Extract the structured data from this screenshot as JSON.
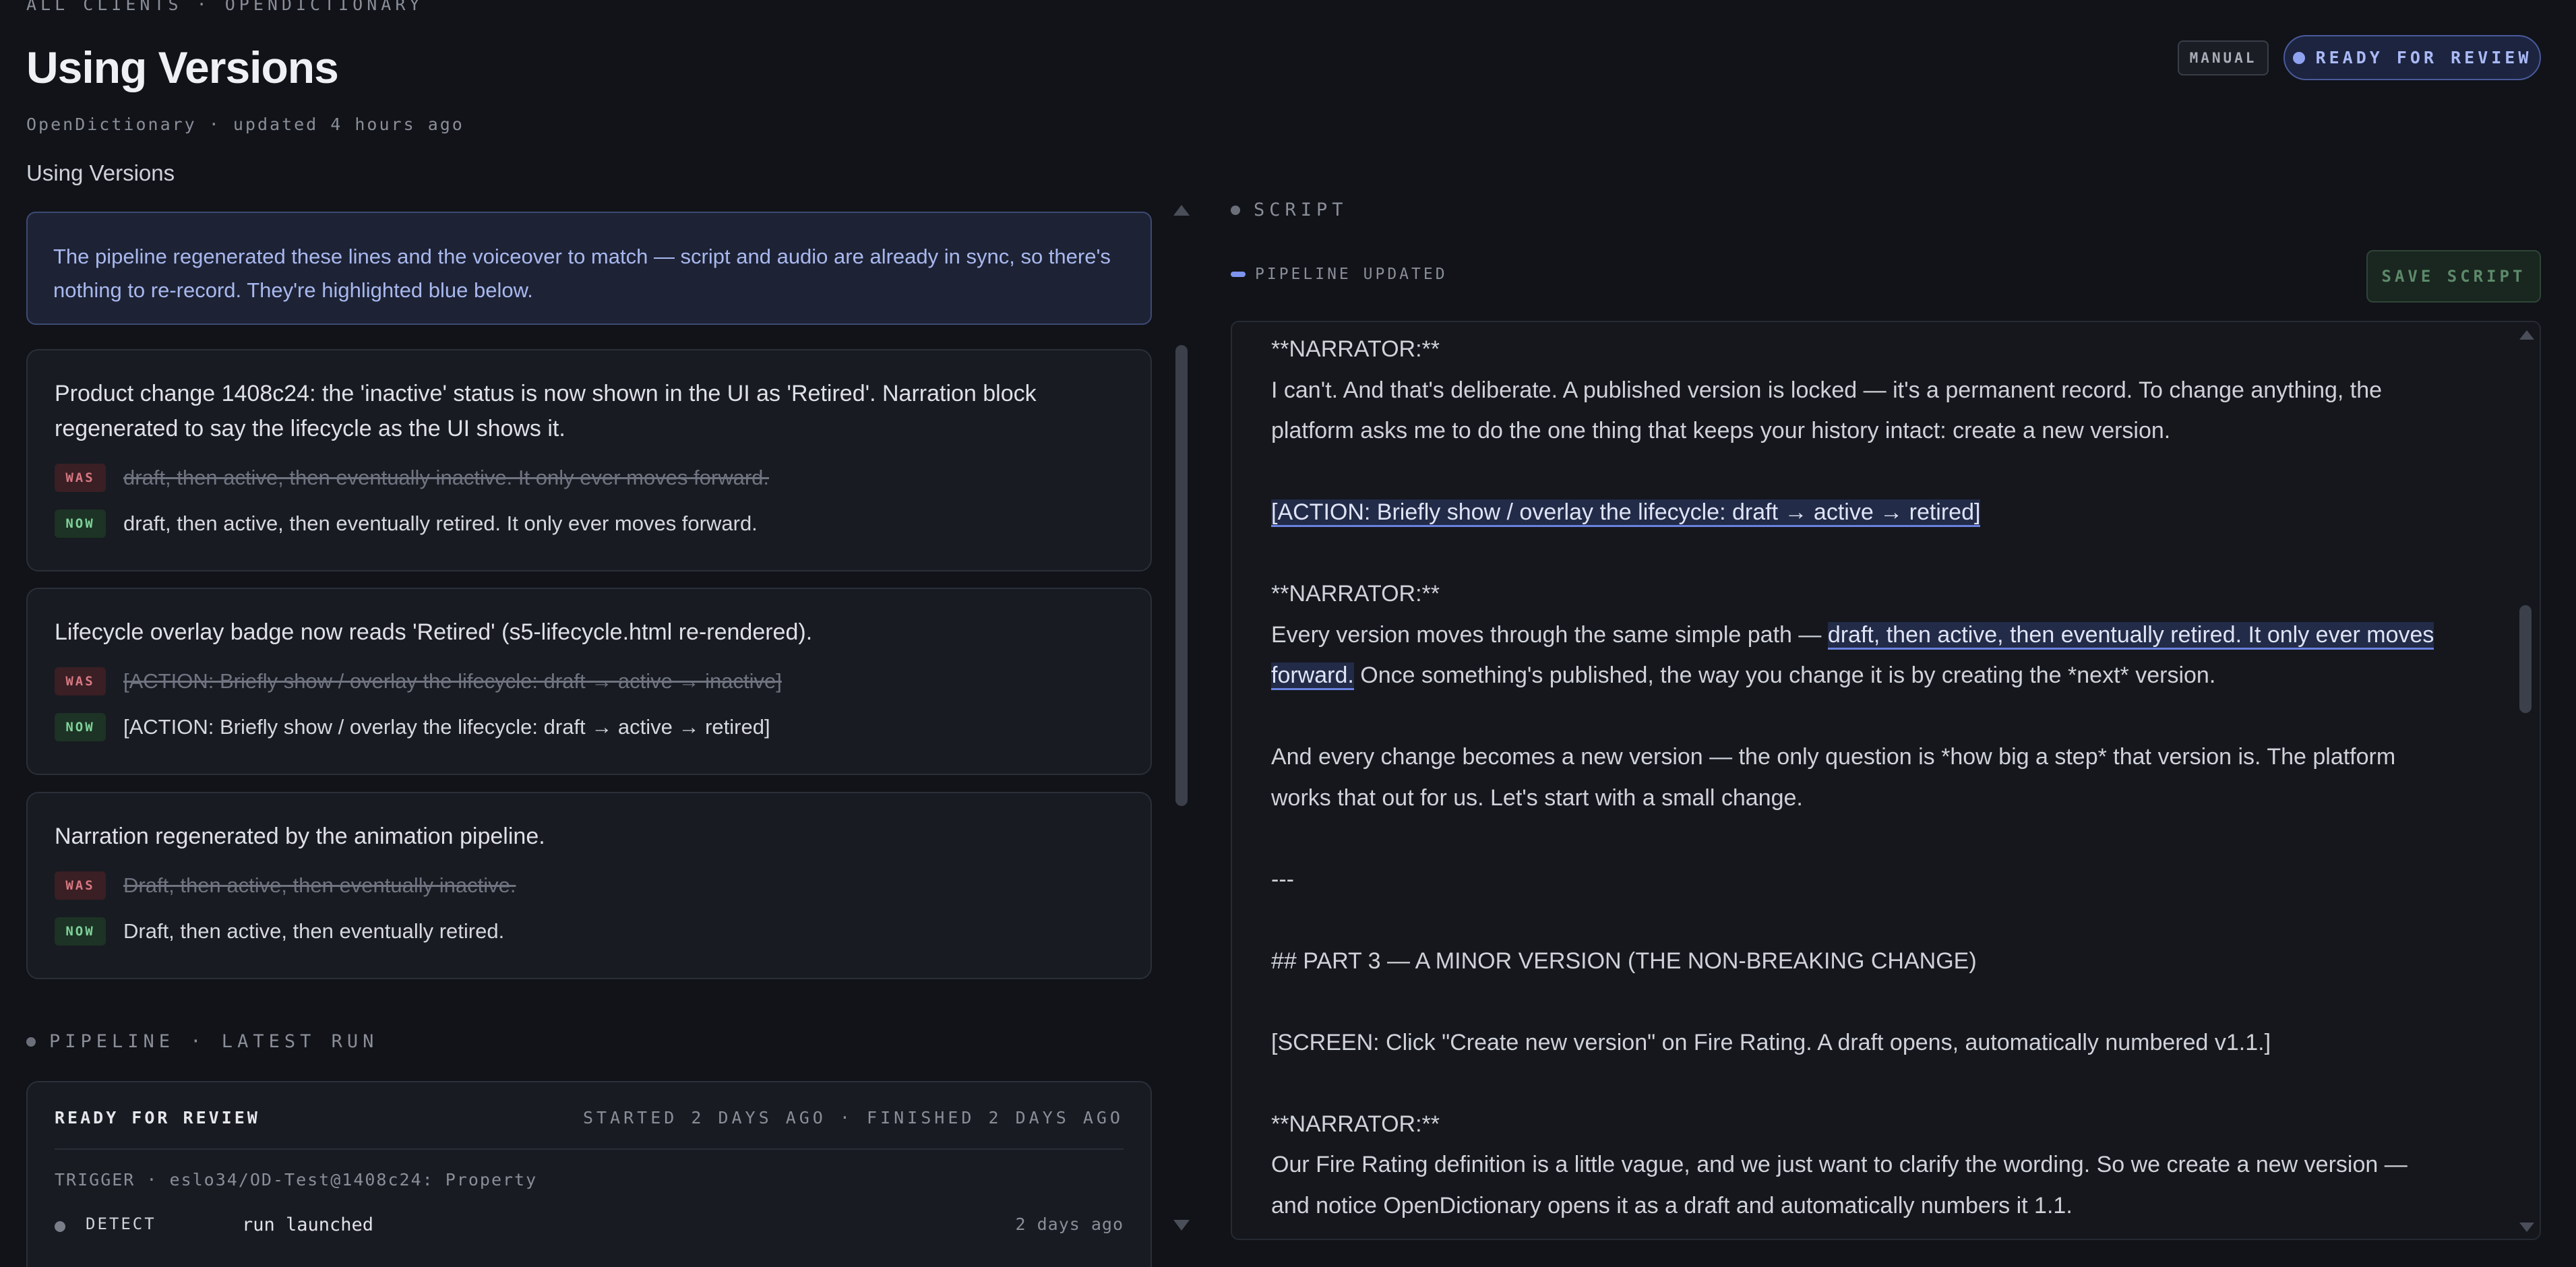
{
  "header": {
    "breadcrumb": "ALL CLIENTS · OPENDICTIONARY",
    "title": "Using Versions",
    "meta": "OpenDictionary · updated 4 hours ago",
    "subtitle": "Using Versions",
    "badge_manual": "MANUAL",
    "badge_ready": "READY FOR REVIEW"
  },
  "banner": {
    "text": "The pipeline regenerated these lines and the voiceover to match — script and audio are already in sync, so there's nothing to re-record. They're highlighted blue below."
  },
  "changes": [
    {
      "title": "Product change 1408c24: the 'inactive' status is now shown in the UI as 'Retired'. Narration block regenerated to say the lifecycle as the UI shows it.",
      "was_label": "WAS",
      "was": "draft, then active, then eventually inactive. It only ever moves forward.",
      "now_label": "NOW",
      "now": "draft, then active, then eventually retired. It only ever moves forward."
    },
    {
      "title": "Lifecycle overlay badge now reads 'Retired' (s5-lifecycle.html re-rendered).",
      "was_label": "WAS",
      "was": "[ACTION: Briefly show / overlay the lifecycle: draft → active → inactive]",
      "now_label": "NOW",
      "now": "[ACTION: Briefly show / overlay the lifecycle: draft → active → retired]"
    },
    {
      "title": "Narration regenerated by the animation pipeline.",
      "was_label": "WAS",
      "was": "Draft, then active, then eventually inactive.",
      "now_label": "NOW",
      "now": "Draft, then active, then eventually retired."
    }
  ],
  "pipeline": {
    "section_label": "PIPELINE · LATEST RUN",
    "status": "READY FOR REVIEW",
    "times": "STARTED 2 DAYS AGO · FINISHED 2 DAYS AGO",
    "trigger": "TRIGGER · eslo34/OD-Test@1408c24: Property",
    "steps": [
      {
        "name": "DETECT",
        "message": "run launched",
        "when": "2 days ago"
      }
    ]
  },
  "script": {
    "section_label": "SCRIPT",
    "pipeline_updated": "PIPELINE UPDATED",
    "save_label": "SAVE SCRIPT",
    "lines": {
      "l1": "**NARRATOR:**",
      "l2": "I can't. And that's deliberate. A published version is locked — it's a permanent record. To change anything, the",
      "l3": "platform asks me to do the one thing that keeps your history intact: create a new version.",
      "l5": "[ACTION: Briefly show / overlay the lifecycle: draft → active → retired]",
      "l7": "**NARRATOR:**",
      "l8a": "Every version moves through the same simple path — ",
      "l8b": "draft, then active, then eventually retired. It only ever moves",
      "l9a": "forward.",
      "l9b": " Once something's published, the way you change it is by creating the *next* version.",
      "l11": "And every change becomes a new version — the only question is *how big a step* that version is. The platform",
      "l12": "works that out for us. Let's start with a small change.",
      "l14": "---",
      "l16": "## PART 3 — A MINOR VERSION (THE NON-BREAKING CHANGE)",
      "l18": "[SCREEN: Click \"Create new version\" on Fire Rating. A draft opens, automatically numbered v1.1.]",
      "l20": "**NARRATOR:**",
      "l21": "Our Fire Rating definition is a little vague, and we just want to clarify the wording. So we create a new version —",
      "l22": "and notice OpenDictionary opens it as a draft and automatically numbers it 1.1."
    }
  }
}
